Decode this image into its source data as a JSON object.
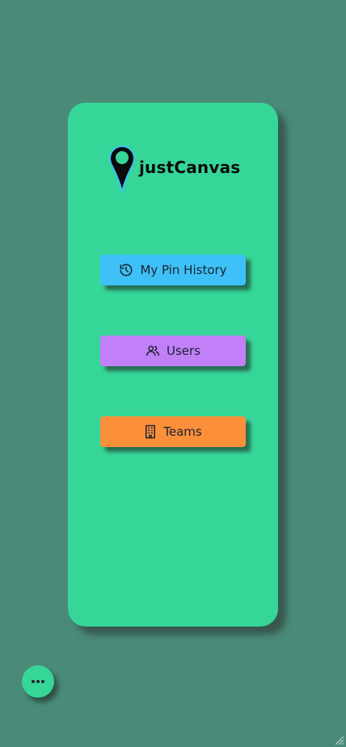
{
  "app": {
    "brand_name": "justCanvas"
  },
  "nav": {
    "buttons": [
      {
        "label": "My Pin History",
        "icon": "history-icon",
        "color": "#3ec1f6"
      },
      {
        "label": "Users",
        "icon": "users-icon",
        "color": "#c180f7"
      },
      {
        "label": "Teams",
        "icon": "building-icon",
        "color": "#fc8f3a"
      }
    ]
  },
  "fab": {
    "icon": "more-dots-icon"
  },
  "colors": {
    "background": "#4a8a78",
    "card": "#36d698",
    "pin_outline": "#3ec1f6"
  }
}
